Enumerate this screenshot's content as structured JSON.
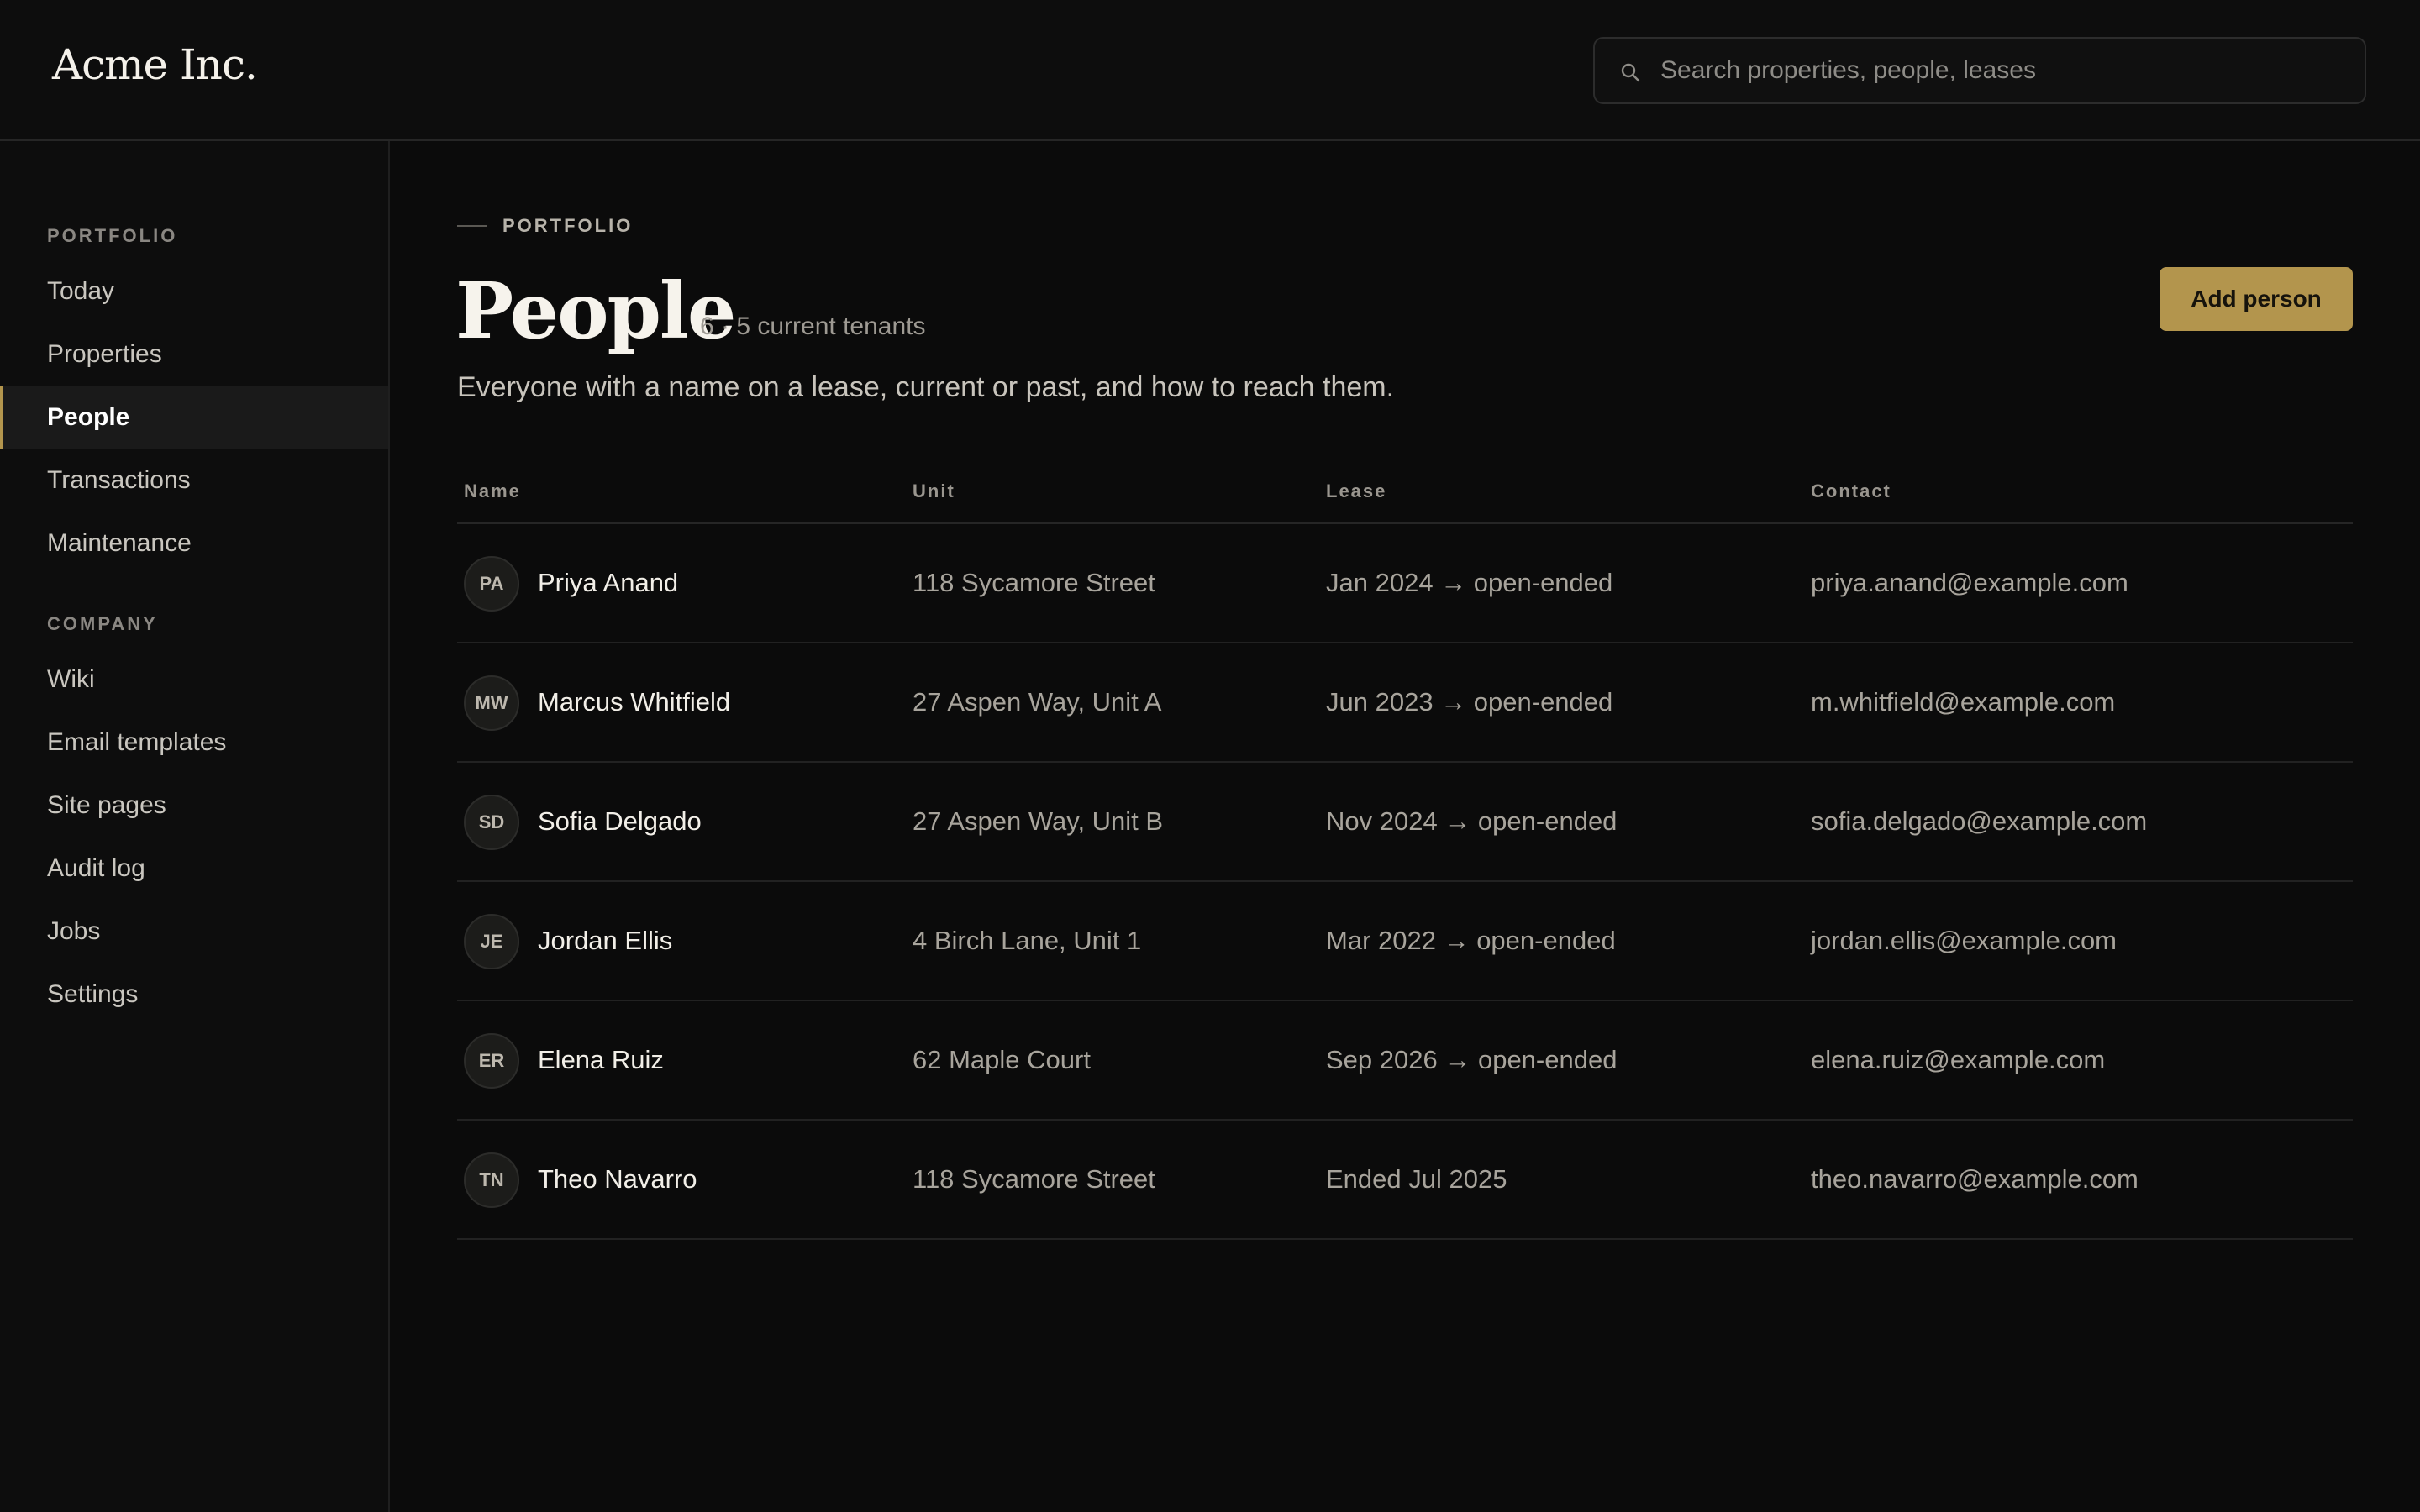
{
  "header": {
    "logo": "Acme Inc.",
    "search_placeholder": "Search properties, people, leases"
  },
  "sidebar": {
    "sections": [
      {
        "label": "PORTFOLIO",
        "items": [
          "Today",
          "Properties",
          "People",
          "Transactions",
          "Maintenance"
        ]
      },
      {
        "label": "COMPANY",
        "items": [
          "Wiki",
          "Email templates",
          "Site pages",
          "Audit log",
          "Jobs",
          "Settings"
        ]
      }
    ],
    "active_item": "People"
  },
  "main": {
    "eyebrow": "PORTFOLIO",
    "title": "People",
    "meta": "6 · 5 current tenants",
    "description": "Everyone with a name on a lease, current or past, and how to reach them.",
    "add_button": "Add person",
    "accent_color": "#b3954d"
  },
  "table": {
    "columns": [
      "Name",
      "Unit",
      "Lease",
      "Contact"
    ],
    "rows": [
      {
        "initials": "PA",
        "name": "Priya Anand",
        "unit": "118 Sycamore Street",
        "lease": "Jan 2024 → open-ended",
        "contact": "priya.anand@example.com"
      },
      {
        "initials": "MW",
        "name": "Marcus Whitfield",
        "unit": "27 Aspen Way, Unit A",
        "lease": "Jun 2023 → open-ended",
        "contact": "m.whitfield@example.com"
      },
      {
        "initials": "SD",
        "name": "Sofia Delgado",
        "unit": "27 Aspen Way, Unit B",
        "lease": "Nov 2024 → open-ended",
        "contact": "sofia.delgado@example.com"
      },
      {
        "initials": "JE",
        "name": "Jordan Ellis",
        "unit": "4 Birch Lane, Unit 1",
        "lease": "Mar 2022 → open-ended",
        "contact": "jordan.ellis@example.com"
      },
      {
        "initials": "ER",
        "name": "Elena Ruiz",
        "unit": "62 Maple Court",
        "lease": "Sep 2026 → open-ended",
        "contact": "elena.ruiz@example.com"
      },
      {
        "initials": "TN",
        "name": "Theo Navarro",
        "unit": "118 Sycamore Street",
        "lease": "Ended Jul 2025",
        "contact": "theo.navarro@example.com"
      }
    ]
  }
}
